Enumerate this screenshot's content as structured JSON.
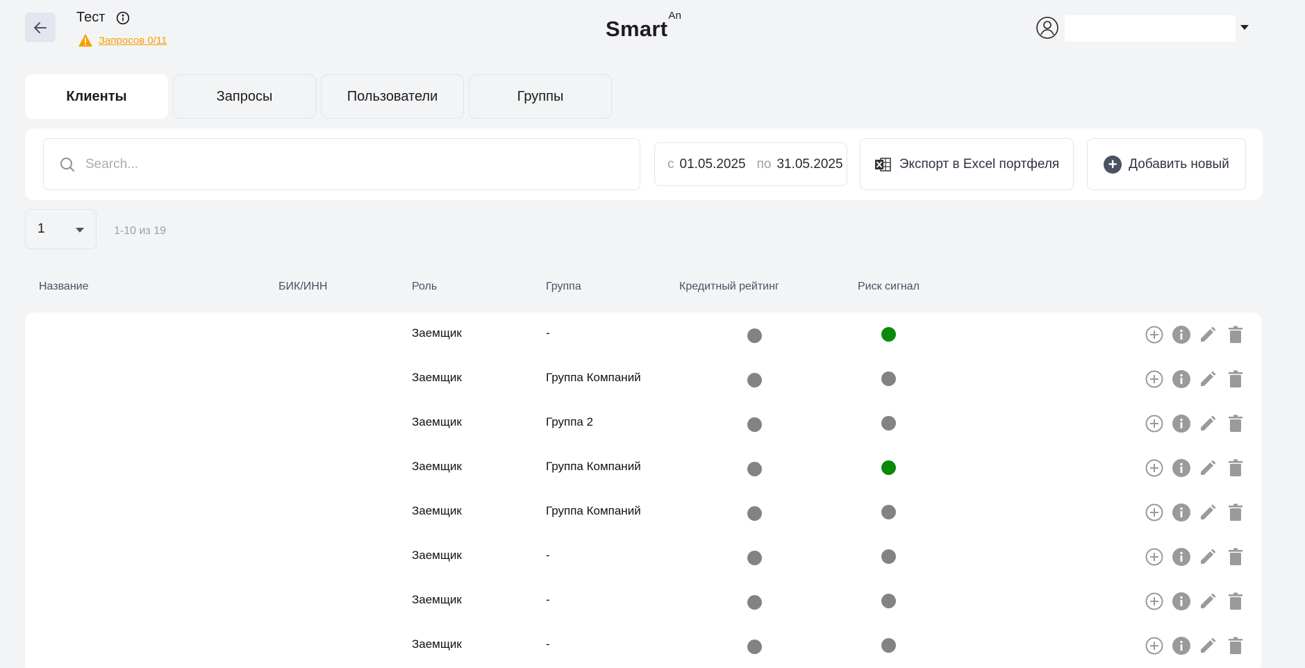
{
  "header": {
    "title": "Тест",
    "requests_link": "Запросов 0/11",
    "logo_main": "Smart",
    "logo_sup": "An",
    "user_name": ""
  },
  "tabs": [
    {
      "label": "Клиенты",
      "active": true
    },
    {
      "label": "Запросы",
      "active": false
    },
    {
      "label": "Пользователи",
      "active": false
    },
    {
      "label": "Группы",
      "active": false
    }
  ],
  "toolbar": {
    "search_placeholder": "Search...",
    "date_from_label": "с",
    "date_from": "01.05.2025",
    "date_to_label": "по",
    "date_to": "31.05.2025",
    "export_label": "Экспорт в Excel портфеля",
    "add_label": "Добавить новый"
  },
  "pagination": {
    "page": "1",
    "info": "1-10 из 19"
  },
  "table": {
    "headers": [
      "Название",
      "БИК/ИНН",
      "Роль",
      "Группа",
      "Кредитный рейтинг",
      "Риск сигнал"
    ],
    "rows": [
      {
        "name": "",
        "inn": "",
        "role": "Заемщик",
        "group": "-",
        "rating": "gray",
        "risk": "green"
      },
      {
        "name": "",
        "inn": "",
        "role": "Заемщик",
        "group": "Группа Компаний",
        "rating": "gray",
        "risk": "gray"
      },
      {
        "name": "",
        "inn": "",
        "role": "Заемщик",
        "group": "Группа 2",
        "rating": "gray",
        "risk": "gray"
      },
      {
        "name": "",
        "inn": "",
        "role": "Заемщик",
        "group": "Группа Компаний",
        "rating": "gray",
        "risk": "green"
      },
      {
        "name": "",
        "inn": "",
        "role": "Заемщик",
        "group": "Группа Компаний",
        "rating": "gray",
        "risk": "gray"
      },
      {
        "name": "",
        "inn": "",
        "role": "Заемщик",
        "group": "-",
        "rating": "gray",
        "risk": "gray"
      },
      {
        "name": "",
        "inn": "",
        "role": "Заемщик",
        "group": "-",
        "rating": "gray",
        "risk": "gray"
      },
      {
        "name": "",
        "inn": "",
        "role": "Заемщик",
        "group": "-",
        "rating": "gray",
        "risk": "gray"
      }
    ],
    "row_actions": [
      "add-circle-icon",
      "info-icon",
      "edit-pencil-icon",
      "delete-trash-icon"
    ]
  },
  "colors": {
    "accent_warning": "#f5a000",
    "status_gray": "#838383",
    "status_green": "#0a8a0a",
    "icon_gray": "#9a9a9a"
  }
}
